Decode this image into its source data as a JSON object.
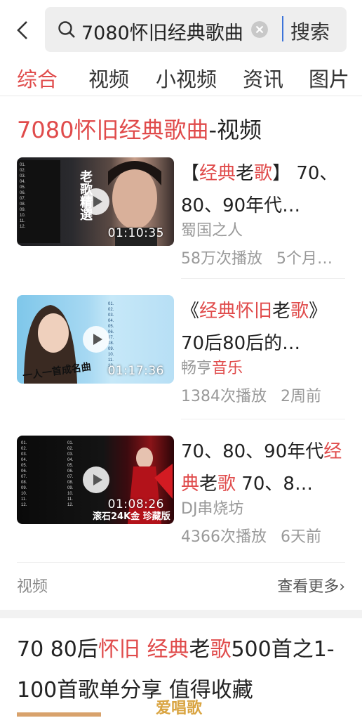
{
  "search": {
    "query": "7080怀旧经典歌曲",
    "button": "搜索"
  },
  "tabs": [
    "综合",
    "视频",
    "小视频",
    "资讯",
    "图片"
  ],
  "section": {
    "title_highlight": "7080怀旧经典歌曲",
    "title_suffix": "-视频",
    "items": [
      {
        "title_parts": [
          [
            "【",
            false
          ],
          [
            "经典",
            true
          ],
          [
            "老",
            false
          ],
          [
            "歌",
            true
          ],
          [
            "】 70、80、90年代…",
            false
          ]
        ],
        "source": "蜀国之人",
        "plays": "58万次播放",
        "time": "5个月…",
        "duration": "01:10:35",
        "thumb_text": "老歌精選"
      },
      {
        "title_parts": [
          [
            "《",
            false
          ],
          [
            "经典",
            true
          ],
          [
            "怀旧",
            true
          ],
          [
            "老",
            false
          ],
          [
            "歌",
            true
          ],
          [
            "》70后80后的…",
            false
          ]
        ],
        "source_parts": [
          [
            "畅亨",
            false
          ],
          [
            "音乐",
            true
          ]
        ],
        "plays": "1384次播放",
        "time": "2周前",
        "duration": "01:17:36",
        "thumb_text": "一人一首成名曲"
      },
      {
        "title_parts": [
          [
            "70、80、90年代",
            false
          ],
          [
            "经典",
            true
          ],
          [
            "老",
            false
          ],
          [
            "歌",
            true
          ],
          [
            " 70、8…",
            false
          ]
        ],
        "source": "DJ串烧坊",
        "plays": "4366次播放",
        "time": "6天前",
        "duration": "01:08:26",
        "thumb_text": "滚石24K金 珍藏版"
      }
    ],
    "footer_left": "视频",
    "footer_right": "查看更多›"
  },
  "article": {
    "title_parts": [
      [
        "70 80后",
        false
      ],
      [
        "怀旧",
        true
      ],
      [
        " ",
        false
      ],
      [
        "经典",
        true
      ],
      [
        "老",
        false
      ],
      [
        "歌",
        true
      ],
      [
        "500首之1-100首歌单分享 值得收藏",
        false
      ]
    ]
  },
  "watermark": "爱唱歌",
  "colors": {
    "accent": "#e04b4b",
    "gray_text": "#999999",
    "caret": "#3b73d9"
  }
}
